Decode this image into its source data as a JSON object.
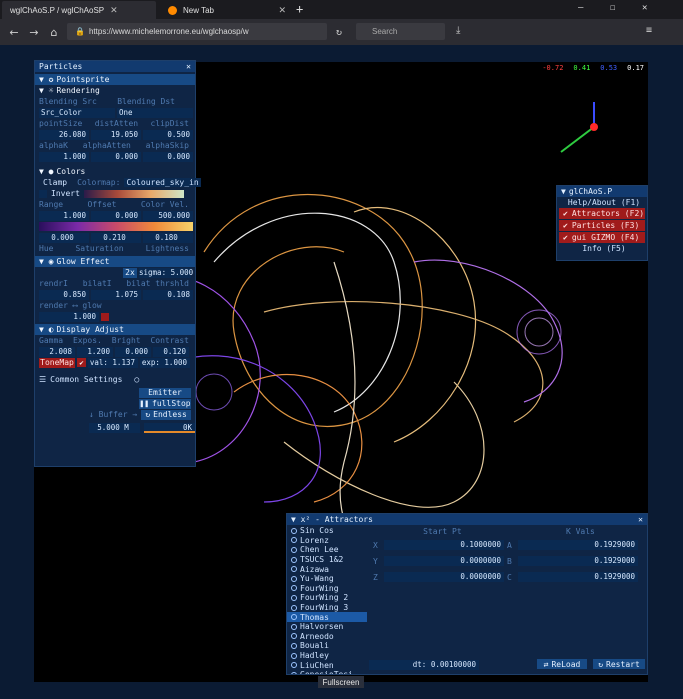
{
  "browser": {
    "tabs": [
      {
        "title": "wglChAoS.P / wglChAoSP",
        "active": true
      },
      {
        "title": "New Tab",
        "active": false
      }
    ],
    "url": "https://www.michelemorrone.eu/wglchaosp/w",
    "search_placeholder": "Search"
  },
  "fullscreen_label": "Fullscreen",
  "fps_readout": {
    "r": "-0.72",
    "g": "0.41",
    "b": "0.53",
    "fps": "0.17"
  },
  "particles_panel": {
    "title": "Particles",
    "pointsprite": "Pointsprite",
    "rendering": "Rendering",
    "blend_src_label": "Blending Src",
    "blend_dst_label": "Blending Dst",
    "blend_src": "Src_Color",
    "blend_dst": "One",
    "row1_labels": [
      "pointSize",
      "distAtten",
      "clipDist"
    ],
    "row1_values": [
      "26.080",
      "19.050",
      "0.500"
    ],
    "row2_labels": [
      "alphaK",
      "alphaAtten",
      "alphaSkip"
    ],
    "row2_values": [
      "1.000",
      "0.000",
      "0.000"
    ],
    "colors": "Colors",
    "clamp": "Clamp",
    "colormap_label": "Colormap:",
    "colormap": "Coloured_sky_in",
    "invert": "Invert",
    "range_labels": [
      "Range",
      "Offset",
      "Color Vel."
    ],
    "range_values": [
      "1.000",
      "0.000",
      "500.000"
    ],
    "hsl_values": [
      "0.000",
      "0.210",
      "0.180"
    ],
    "hsl_labels": [
      "Hue",
      "Saturation",
      "Lightness"
    ],
    "glow_effect": "Glow Effect",
    "glow_2x": "2x",
    "sigma": "sigma: 5.000",
    "glow_labels": [
      "rendrI",
      "bilatI",
      "bilat thrshld"
    ],
    "glow_values": [
      "0.850",
      "1.075",
      "0.108"
    ],
    "render_glow_label": "render ⟷ glow",
    "render_glow_value": "1.000",
    "display_adjust": "Display Adjust",
    "disp_labels": [
      "Gamma",
      "Expos.",
      "Bright",
      "Contrast"
    ],
    "disp_values": [
      "2.008",
      "1.200",
      "0.000",
      "0.120"
    ],
    "tonemap": "ToneMap",
    "tm_val": "val: 1.137",
    "tm_exp": "exp: 1.000",
    "common_settings": "Common Settings",
    "emitter": "Emitter",
    "fullstop": "fullStop",
    "endless": "Endless",
    "buffer": "Buffer",
    "buffer_value": "5.000 M",
    "count_value": "0K"
  },
  "glchaos_panel": {
    "title": "glChAoS.P",
    "items": [
      {
        "label": "Help/About (F1)",
        "checked": false
      },
      {
        "label": "Attractors (F2)",
        "checked": true
      },
      {
        "label": "Particles  (F3)",
        "checked": true
      },
      {
        "label": "gui GIZMO  (F4)",
        "checked": true
      },
      {
        "label": "Info       (F5)",
        "checked": false
      }
    ]
  },
  "attractors_panel": {
    "title": "x² - Attractors",
    "list": [
      "Sin Cos",
      "Lorenz",
      "Chen Lee",
      "TSUCS 1&2",
      "Aizawa",
      "Yu-Wang",
      "FourWing",
      "FourWing 2",
      "FourWing 3",
      "Thomas",
      "Halvorsen",
      "Arneodo",
      "Bouali",
      "Hadley",
      "LiuChen",
      "GenesioTesi"
    ],
    "selected": "Thomas",
    "start_pt_label": "Start Pt",
    "k_vals_label": "K Vals",
    "rows": [
      {
        "axis": "X",
        "start": "0.1000000",
        "k": "A",
        "kval": "0.1929000"
      },
      {
        "axis": "Y",
        "start": "0.0000000",
        "k": "B",
        "kval": "0.1929000"
      },
      {
        "axis": "Z",
        "start": "0.0000000",
        "k": "C",
        "kval": "0.1929000"
      }
    ],
    "dt": "dt: 0.00100000",
    "reload": "ReLoad",
    "restart": "Restart"
  }
}
